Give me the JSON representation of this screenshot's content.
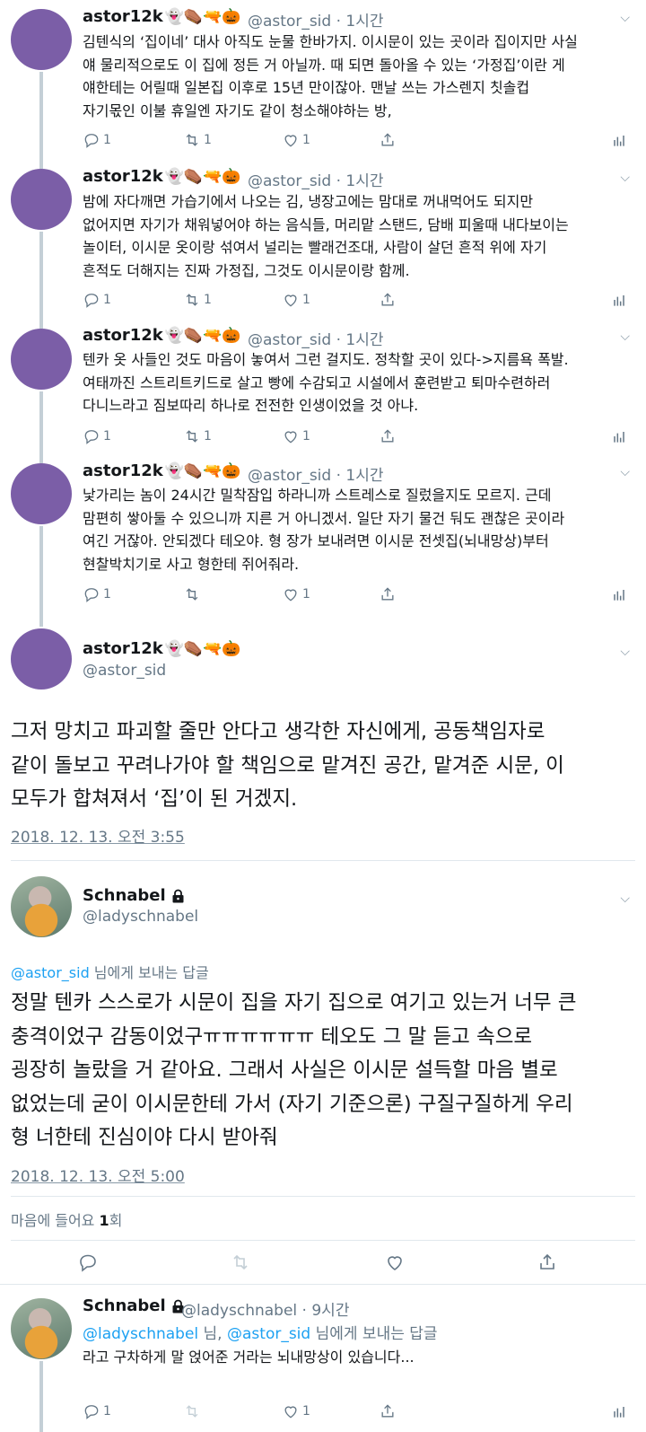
{
  "tweets": [
    {
      "name": "astor12k",
      "emoji": "👻⚰️🔫🎃",
      "handle": "@astor_sid",
      "time": "1시간",
      "text": "김텐식의 ‘집이네’ 대사 아직도 눈물 한바가지. 이시문이 있는 곳이라 집이지만 사실\n얘 물리적으로도 이 집에 정든 거 아닐까. 때 되면 돌아올 수 있는 ‘가정집’이란 게\n얘한테는 어릴때 일본집 이후로 15년 만이잖아. 맨날 쓰는 가스렌지 칫솔컵\n자기몫인 이불 휴일엔 자기도 같이 청소해야하는 방,",
      "reply_count": "1",
      "retweet_count": "1",
      "like_count": "1"
    },
    {
      "name": "astor12k",
      "emoji": "👻⚰️🔫🎃",
      "handle": "@astor_sid",
      "time": "1시간",
      "text": "밤에 자다깨면 가습기에서 나오는 김, 냉장고에는 맘대로 꺼내먹어도 되지만\n없어지면 자기가 채워넣어야 하는 음식들, 머리맡 스탠드, 담배 피울때 내다보이는\n놀이터, 이시문 옷이랑 섞여서 널리는 빨래건조대, 사람이 살던 흔적 위에 자기\n흔적도 더해지는 진짜 가정집, 그것도 이시문이랑 함께.",
      "reply_count": "1",
      "retweet_count": "1",
      "like_count": "1"
    },
    {
      "name": "astor12k",
      "emoji": "👻⚰️🔫🎃",
      "handle": "@astor_sid",
      "time": "1시간",
      "text": "텐카 옷 사들인 것도 마음이 놓여서 그런 걸지도. 정착할 곳이 있다->지름욕 폭발.\n여태까진 스트리트키드로 살고 빵에 수감되고 시설에서 훈련받고 퇴마수련하러\n다니느라고 짐보따리 하나로 전전한 인생이었을 것 아냐.",
      "reply_count": "1",
      "retweet_count": "1",
      "like_count": "1"
    },
    {
      "name": "astor12k",
      "emoji": "👻⚰️🔫🎃",
      "handle": "@astor_sid",
      "time": "1시간",
      "text": "낯가리는 놈이 24시간 밀착잠입 하라니까 스트레스로 질렀을지도 모르지. 근데\n맘편히 쌓아둘 수 있으니까 지른 거 아니겠서. 일단 자기 물건 둬도 괜찮은 곳이라\n여긴 거잖아. 안되겠다 테오야. 형 장가 보내려면 이시문 전셋집(뇌내망상)부터\n현찰박치기로 사고 형한테 쥐어줘라.",
      "reply_count": "1",
      "retweet_count": "",
      "like_count": "1"
    }
  ],
  "main_tweet": {
    "name": "astor12k",
    "emoji": "👻⚰️🔫🎃",
    "handle": "@astor_sid",
    "text": "그저 망치고 파괴할 줄만 안다고 생각한 자신에게, 공동책임자로\n같이 돌보고 꾸려나가야 할 책임으로 맡겨진 공간, 맡겨준 시문, 이\n모두가 합쳐져서 ‘집’이 된 거겠지.",
    "timestamp": "2018. 12. 13. 오전 3:55"
  },
  "reply_tweet": {
    "name": "Schnabel",
    "handle": "@ladyschnabel",
    "reply_to_mention": "@astor_sid",
    "reply_to_suffix": " 님에게 보내는 답글",
    "text": "정말 텐카 스스로가 시문이 집을 자기 집으로 여기고 있는거 너무 큰\n충격이었구 감동이었구ㅠㅠㅠㅠㅠㅠ 테오도 그 말 듣고 속으로\n굉장히 놀랐을 거 같아요. 그래서 사실은 이시문 설득할 마음 별로\n없었는데 굳이 이시문한테 가서 (자기 기준으론) 구질구질하게 우리\n형 너한테 진심이야 다시 받아줘",
    "timestamp": "2018. 12. 13. 오전 5:00",
    "likes_prefix": "마음에 들어요 ",
    "likes_count": "1",
    "likes_suffix": "회"
  },
  "last_tweet": {
    "name": "Schnabel",
    "handle": "@ladyschnabel",
    "time": "9시간",
    "reply_mention_1": "@ladyschnabel",
    "reply_mid": " 님, ",
    "reply_mention_2": "@astor_sid",
    "reply_suffix": " 님에게 보내는 답글",
    "text": "라고 구차하게 말 얹어준 거라는 뇌내망상이 있습니다...",
    "reply_count": "1",
    "like_count": "1"
  },
  "colors": {
    "accent": "#1da1f2",
    "muted": "#657786",
    "avatar": "#7b5ea7",
    "thread_line": "#c4cfd6"
  }
}
